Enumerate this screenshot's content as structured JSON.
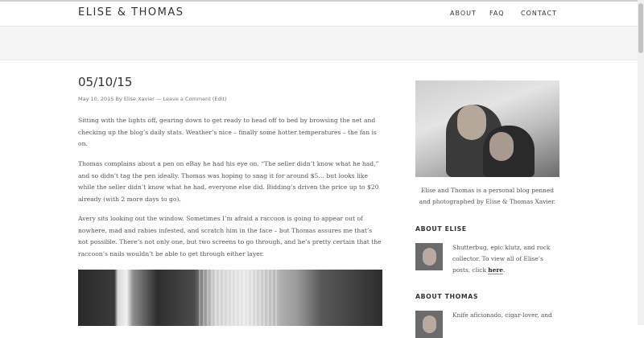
{
  "header": {
    "site_title": "ELISE & THOMAS",
    "nav": [
      "ABOUT",
      "FAQ",
      "CONTACT"
    ]
  },
  "post": {
    "title": "05/10/15",
    "meta": {
      "date": "May 10, 2015",
      "by": "By",
      "author": "Elise Xavier",
      "sep": "—",
      "comment": "Leave a Comment",
      "edit": "(Edit)"
    },
    "paragraphs": [
      "Sitting with the lights off, gearing down to get ready to head off to bed by browsing the net and checking up the blog’s daily stats. Weather’s nice – finally some hotter temperatures – the fan is on.",
      "Thomas complains about a pen on eBay he had his eye on. “The seller didn’t know what he had,” and so didn’t tag the pen ideally. Thomas was hoping to snag it for around $5… but looks like while the seller didn’t know what he had, everyone else did. Bidding’s driven the price up to $20 already (with 2 more days to go).",
      "Avery sits looking out the window. Sometimes I’m afraid a raccoon is going to appear out of nowhere, mad and rabies infested, and scratch him in the face – but Thomas assures me that’s not possible. There’s not only one, but two screens to go through, and he’s pretty certain that the raccoon’s nails wouldn’t be able to get through either layer."
    ]
  },
  "sidebar": {
    "about_text": "Elise and Thomas is a personal blog penned and photographed by Elise & Thomas Xavier.",
    "about_elise": {
      "title": "ABOUT ELISE",
      "text": "Shutterbug, epic klutz, and rock collector. To view all of Elise’s posts, click ",
      "link": "here",
      "end": "."
    },
    "about_thomas": {
      "title": "ABOUT THOMAS",
      "text": "Knife aficionado, cigar-lover, and"
    }
  }
}
